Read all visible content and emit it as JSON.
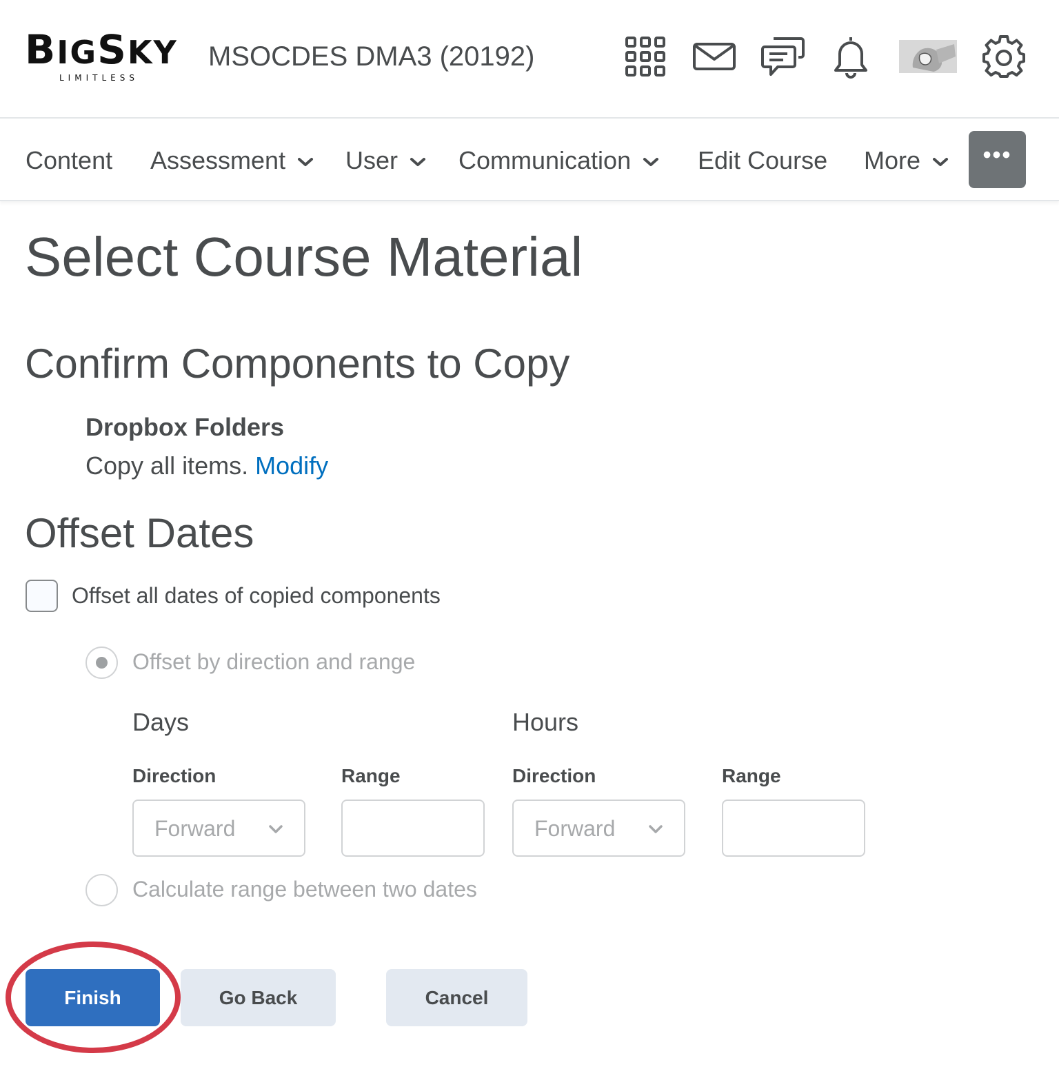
{
  "header": {
    "logo_main": "BigSky",
    "logo_sub": "LIMITLESS",
    "course_title": "MSOCDES DMA3 (20192)",
    "icons": [
      "waffle-grid-icon",
      "mail-icon",
      "chat-bubbles-icon",
      "bell-icon",
      "avatar",
      "gear-icon"
    ]
  },
  "nav": {
    "items": [
      {
        "label": "Content"
      },
      {
        "label": "Assessment"
      },
      {
        "label": "User"
      },
      {
        "label": "Communication"
      },
      {
        "label": "Edit Course"
      },
      {
        "label": "More"
      }
    ],
    "overflow_label": "•••"
  },
  "page": {
    "title": "Select Course Material",
    "confirm_heading": "Confirm Components to Copy",
    "component_name": "Dropbox Folders",
    "component_desc": "Copy all items.",
    "modify_link": "Modify",
    "offset_heading": "Offset Dates",
    "offset_checkbox_label": "Offset all dates of copied components",
    "radio_direction_label": "Offset by direction and range",
    "radio_calculate_label": "Calculate range between two dates",
    "days": {
      "heading": "Days",
      "direction_label": "Direction",
      "direction_value": "Forward",
      "range_label": "Range",
      "range_value": ""
    },
    "hours": {
      "heading": "Hours",
      "direction_label": "Direction",
      "direction_value": "Forward",
      "range_label": "Range",
      "range_value": ""
    }
  },
  "buttons": {
    "finish": "Finish",
    "go_back": "Go Back",
    "cancel": "Cancel"
  },
  "colors": {
    "primary": "#2f6fbf",
    "link": "#006fbf",
    "highlight": "#d43a48",
    "text": "#494c4e",
    "disabled_text": "#a7a9ab",
    "secondary_button": "#e3e9f1"
  }
}
